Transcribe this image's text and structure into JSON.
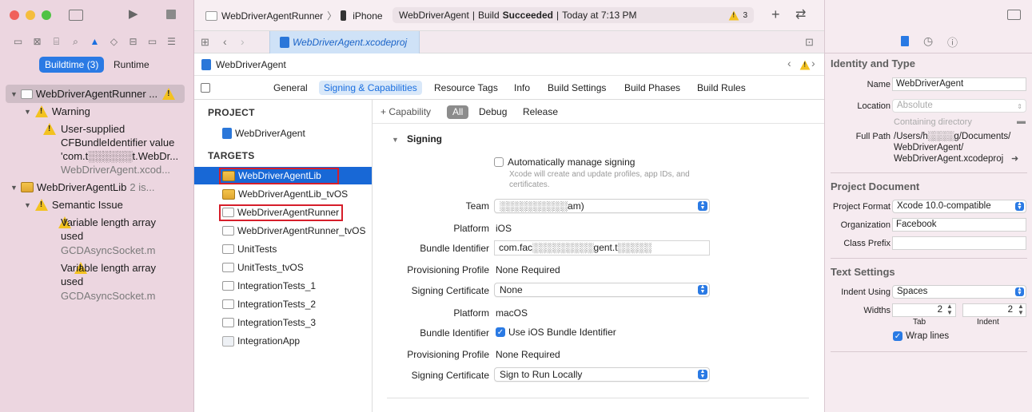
{
  "colors": {
    "accent": "#2a7ae4",
    "selection": "#1868d6",
    "highlight_box": "#d61e2a",
    "warning": "#f3c220",
    "sidebar_bg": "#ecd6e0"
  },
  "toolbar": {
    "scheme": "WebDriverAgentRunner",
    "device": "iPhone",
    "status_project": "WebDriverAgent",
    "status_sep": "|",
    "status_build": "Build",
    "status_result": "Succeeded",
    "status_time": "Today at 7:13 PM",
    "warning_count": "3",
    "add_icon": "plus-icon",
    "back_forward_icon": "arrows-icon"
  },
  "issue_nav": {
    "buildtime_label": "Buildtime (3)",
    "runtime_label": "Runtime",
    "items": [
      {
        "label": "WebDriverAgentRunner ..."
      },
      {
        "label": "Warning"
      },
      {
        "label": "User-supplied CFBundleIdentifier value 'com.t░░░░░░t.WebDr...",
        "line1": "User-supplied",
        "line2": "CFBundleIdentifier value",
        "line3": "'com.t░░░░░░t.WebDr...",
        "sub": "WebDriverAgent.xcod..."
      },
      {
        "label": "WebDriverAgentLib",
        "suffix": "2 is..."
      },
      {
        "label": "Semantic Issue"
      },
      {
        "line1": "Variable length array",
        "line2": "used",
        "sub": "GCDAsyncSocket.m"
      },
      {
        "line1": "Variable length array",
        "line2": "used",
        "sub": "GCDAsyncSocket.m"
      }
    ]
  },
  "tabs": {
    "file_tab": "WebDriverAgent.xcodeproj"
  },
  "breadcrumb": {
    "project": "WebDriverAgent"
  },
  "editor_tabs": [
    "General",
    "Signing & Capabilities",
    "Resource Tags",
    "Info",
    "Build Settings",
    "Build Phases",
    "Build Rules"
  ],
  "project_list": {
    "project_header": "PROJECT",
    "project": "WebDriverAgent",
    "targets_header": "TARGETS",
    "targets": [
      "WebDriverAgentLib",
      "WebDriverAgentLib_tvOS",
      "WebDriverAgentRunner",
      "WebDriverAgentRunner_tvOS",
      "UnitTests",
      "UnitTests_tvOS",
      "IntegrationTests_1",
      "IntegrationTests_2",
      "IntegrationTests_3",
      "IntegrationApp"
    ]
  },
  "signing": {
    "capability_button": "+ Capability",
    "filters": [
      "All",
      "Debug",
      "Release"
    ],
    "section_title": "Signing",
    "auto_manage": "Automatically manage signing",
    "auto_manage_help": "Xcode will create and update profiles, app IDs, and certificates.",
    "team_label": "Team",
    "team_value": "░░░░░░░░░░am)",
    "ios": {
      "platform_label": "Platform",
      "platform_value": "iOS",
      "bundle_label": "Bundle Identifier",
      "bundle_value": "com.fac░░░░░░░░░gent.t░░░░░",
      "profile_label": "Provisioning Profile",
      "profile_value": "None Required",
      "cert_label": "Signing Certificate",
      "cert_value": "None"
    },
    "macos": {
      "platform_label": "Platform",
      "platform_value": "macOS",
      "bundle_label": "Bundle Identifier",
      "bundle_value": "Use iOS Bundle Identifier",
      "profile_label": "Provisioning Profile",
      "profile_value": "None Required",
      "cert_label": "Signing Certificate",
      "cert_value": "Sign to Run Locally"
    }
  },
  "inspector": {
    "identity_header": "Identity and Type",
    "name_label": "Name",
    "name_value": "WebDriverAgent",
    "location_label": "Location",
    "location_value": "Absolute",
    "location_sub": "Containing directory",
    "fullpath_label": "Full Path",
    "fullpath_line1": "/Users/h░░░░g/Documents/",
    "fullpath_line2": "WebDriverAgent/",
    "fullpath_line3": "WebDriverAgent.xcodeproj",
    "project_doc_header": "Project Document",
    "format_label": "Project Format",
    "format_value": "Xcode 10.0-compatible",
    "org_label": "Organization",
    "org_value": "Facebook",
    "prefix_label": "Class Prefix",
    "prefix_value": "",
    "text_header": "Text Settings",
    "indent_label": "Indent Using",
    "indent_value": "Spaces",
    "widths_label": "Widths",
    "tab_value": "2",
    "indent_width_value": "2",
    "tab_caption": "Tab",
    "indent_caption": "Indent",
    "wrap_label": "Wrap lines"
  }
}
